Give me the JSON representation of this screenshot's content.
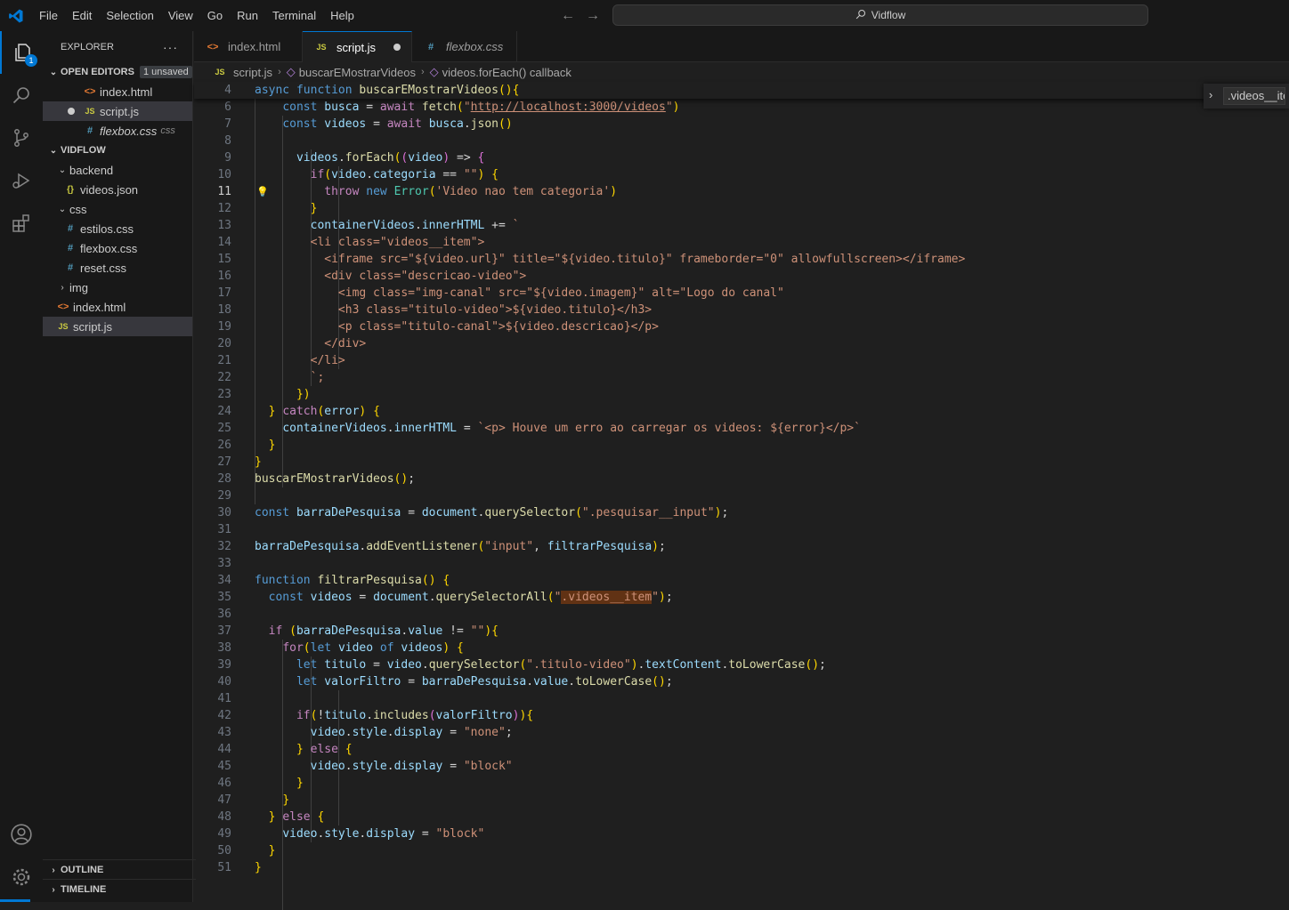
{
  "menu": [
    "File",
    "Edit",
    "Selection",
    "View",
    "Go",
    "Run",
    "Terminal",
    "Help"
  ],
  "search": {
    "label": "Vidflow"
  },
  "activity": {
    "explorer_badge": "1"
  },
  "sidebar": {
    "title": "EXPLORER",
    "more": "···",
    "open_editors": {
      "label": "OPEN EDITORS",
      "badge": "1 unsaved",
      "files": [
        {
          "name": "index.html",
          "icon": "<>"
        },
        {
          "name": "script.js",
          "icon": "JS"
        },
        {
          "name": "flexbox.css",
          "icon": "#",
          "hint": "css"
        }
      ]
    },
    "project": {
      "label": "VIDFLOW",
      "items": [
        {
          "name": "backend",
          "icon": "v"
        },
        {
          "name": "videos.json",
          "icon": "{}"
        },
        {
          "name": "css",
          "icon": "v"
        },
        {
          "name": "estilos.css",
          "icon": "#"
        },
        {
          "name": "flexbox.css",
          "icon": "#"
        },
        {
          "name": "reset.css",
          "icon": "#"
        },
        {
          "name": "img",
          "icon": ">"
        },
        {
          "name": "index.html",
          "icon": "<>"
        },
        {
          "name": "script.js",
          "icon": "JS"
        }
      ]
    },
    "outline": "OUTLINE",
    "timeline": "TIMELINE"
  },
  "tabs": [
    {
      "label": "index.html",
      "icon": "<>"
    },
    {
      "label": "script.js",
      "icon": "JS"
    },
    {
      "label": "flexbox.css",
      "icon": "#"
    }
  ],
  "breadcrumb": [
    "script.js",
    "buscarEMostrarVideos",
    "videos.forEach() callback"
  ],
  "find_widget": {
    "value": ".videos__item"
  },
  "colors": {
    "accent": "#0078d4",
    "editor_bg": "#1f1f1f",
    "sidebar_bg": "#181818",
    "keyword": "#569cd6",
    "string": "#ce9178",
    "function": "#dcdcaa",
    "variable": "#9cdcfe"
  },
  "code": {
    "current_line": 11,
    "lines": [
      {
        "n": 4,
        "t": "async function buscarEMostrarVideos(){"
      },
      {
        "n": 6,
        "t": "    const busca = await fetch(\"http://localhost:3000/videos\")"
      },
      {
        "n": 7,
        "t": "    const videos = await busca.json()"
      },
      {
        "n": 8,
        "t": ""
      },
      {
        "n": 9,
        "t": "      videos.forEach((video) => {"
      },
      {
        "n": 10,
        "t": "        if(video.categoria == \"\") {"
      },
      {
        "n": 11,
        "t": "          throw new Error('Video nao tem categoria')"
      },
      {
        "n": 12,
        "t": "        }"
      },
      {
        "n": 13,
        "t": "        containerVideos.innerHTML += `"
      },
      {
        "n": 14,
        "t": "        <li class=\"videos__item\">"
      },
      {
        "n": 15,
        "t": "          <iframe src=\"${video.url}\" title=\"${video.titulo}\" frameborder=\"0\" allowfullscreen></iframe>"
      },
      {
        "n": 16,
        "t": "          <div class=\"descricao-video\">"
      },
      {
        "n": 17,
        "t": "            <img class=\"img-canal\" src=\"${video.imagem}\" alt=\"Logo do canal\""
      },
      {
        "n": 18,
        "t": "            <h3 class=\"titulo-video\">${video.titulo}</h3>"
      },
      {
        "n": 19,
        "t": "            <p class=\"titulo-canal\">${video.descricao}</p>"
      },
      {
        "n": 20,
        "t": "          </div>"
      },
      {
        "n": 21,
        "t": "        </li>"
      },
      {
        "n": 22,
        "t": "        `;"
      },
      {
        "n": 23,
        "t": "      })"
      },
      {
        "n": 24,
        "t": "  } catch(error) {"
      },
      {
        "n": 25,
        "t": "    containerVideos.innerHTML = `<p> Houve um erro ao carregar os videos: ${error}</p>`"
      },
      {
        "n": 26,
        "t": "  }"
      },
      {
        "n": 27,
        "t": "}"
      },
      {
        "n": 28,
        "t": "buscarEMostrarVideos();"
      },
      {
        "n": 29,
        "t": ""
      },
      {
        "n": 30,
        "t": "const barraDePesquisa = document.querySelector(\".pesquisar__input\");"
      },
      {
        "n": 31,
        "t": ""
      },
      {
        "n": 32,
        "t": "barraDePesquisa.addEventListener(\"input\", filtrarPesquisa);"
      },
      {
        "n": 33,
        "t": ""
      },
      {
        "n": 34,
        "t": "function filtrarPesquisa() {"
      },
      {
        "n": 35,
        "t": "  const videos = document.querySelectorAll(\".videos__item\");"
      },
      {
        "n": 36,
        "t": ""
      },
      {
        "n": 37,
        "t": "  if (barraDePesquisa.value != \"\"){"
      },
      {
        "n": 38,
        "t": "    for(let video of videos) {"
      },
      {
        "n": 39,
        "t": "      let titulo = video.querySelector(\".titulo-video\").textContent.toLowerCase();"
      },
      {
        "n": 40,
        "t": "      let valorFiltro = barraDePesquisa.value.toLowerCase();"
      },
      {
        "n": 41,
        "t": ""
      },
      {
        "n": 42,
        "t": "      if(!titulo.includes(valorFiltro)){"
      },
      {
        "n": 43,
        "t": "        video.style.display = \"none\";"
      },
      {
        "n": 44,
        "t": "      } else {"
      },
      {
        "n": 45,
        "t": "        video.style.display = \"block\""
      },
      {
        "n": 46,
        "t": "      }"
      },
      {
        "n": 47,
        "t": "    }"
      },
      {
        "n": 48,
        "t": "  } else {"
      },
      {
        "n": 49,
        "t": "    video.style.display = \"block\""
      },
      {
        "n": 50,
        "t": "  }"
      },
      {
        "n": 51,
        "t": "}"
      }
    ]
  }
}
